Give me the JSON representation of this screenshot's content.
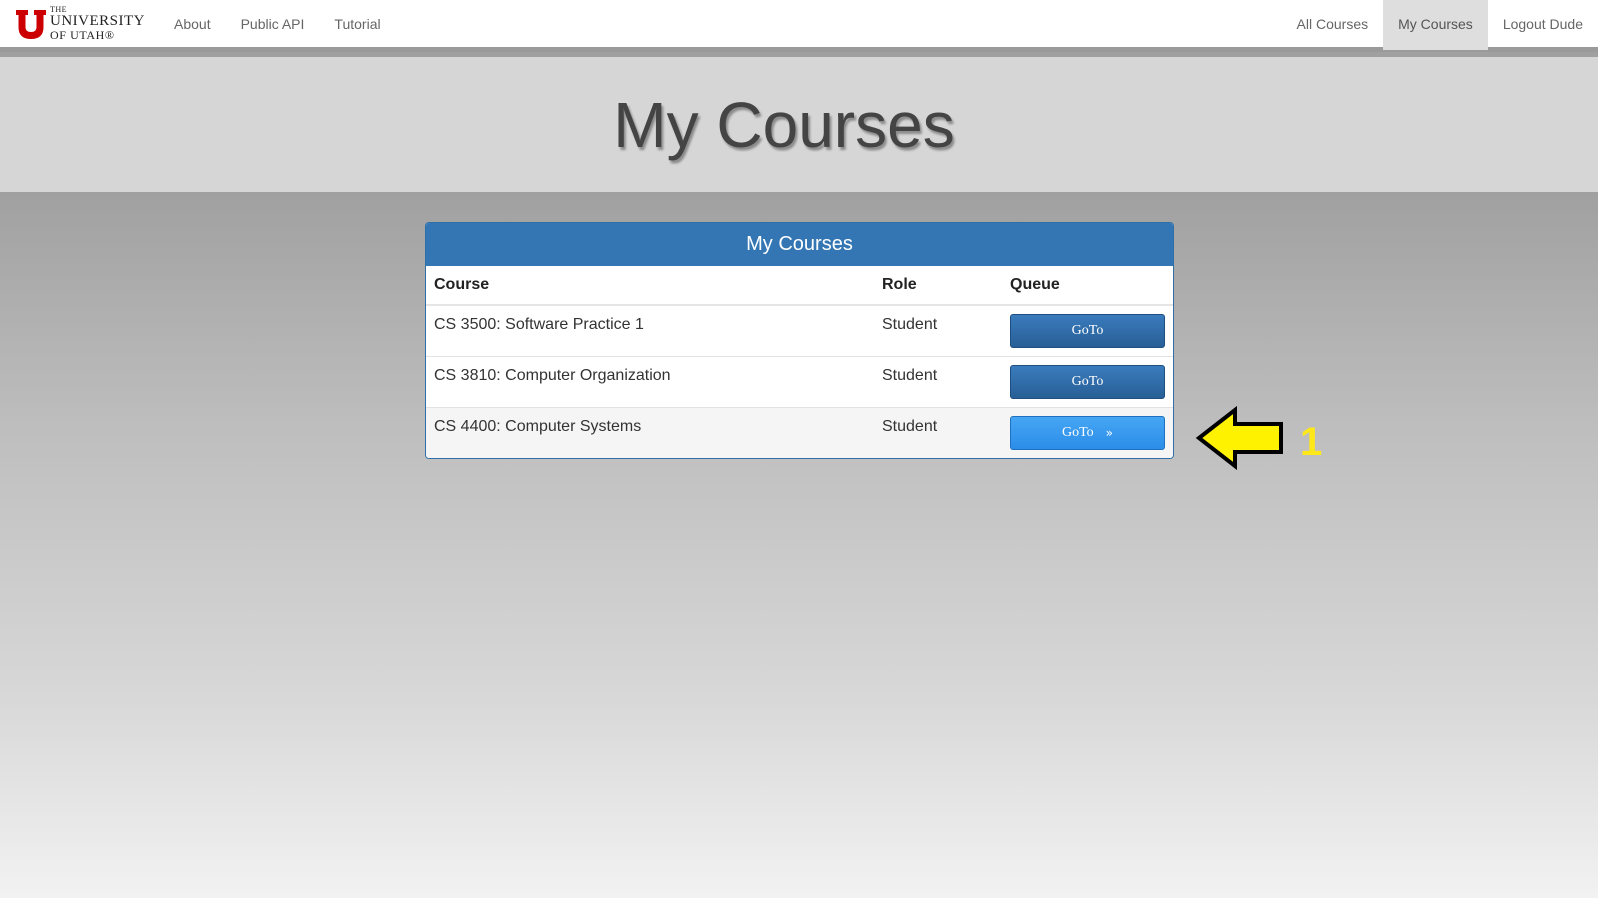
{
  "navbar": {
    "logo": {
      "line1": "THE",
      "line2": "UNIVERSITY",
      "line3": "OF UTAH®",
      "color": "#cc0000"
    },
    "left_links": [
      {
        "label": "About"
      },
      {
        "label": "Public API"
      },
      {
        "label": "Tutorial"
      }
    ],
    "right_links": [
      {
        "label": "All Courses",
        "active": false
      },
      {
        "label": "My Courses",
        "active": true
      },
      {
        "label": "Logout Dude",
        "active": false
      }
    ]
  },
  "page": {
    "title": "My Courses"
  },
  "panel": {
    "heading": "My Courses",
    "columns": [
      "Course",
      "Role",
      "Queue"
    ],
    "rows": [
      {
        "course": "CS 3500: Software Practice 1",
        "role": "Student",
        "button": "GoTo"
      },
      {
        "course": "CS 3810: Computer Organization",
        "role": "Student",
        "button": "GoTo"
      },
      {
        "course": "CS 4400: Computer Systems",
        "role": "Student",
        "button": "GoTo",
        "button_suffix": "»",
        "hovered": true
      }
    ]
  },
  "annotation": {
    "label": "1",
    "color": "#ffe81a",
    "icon": "left-arrow-icon"
  },
  "colors": {
    "panel_heading": "#3376b3",
    "button_dark": "#2f6da8",
    "button_light": "#3a9af0"
  }
}
